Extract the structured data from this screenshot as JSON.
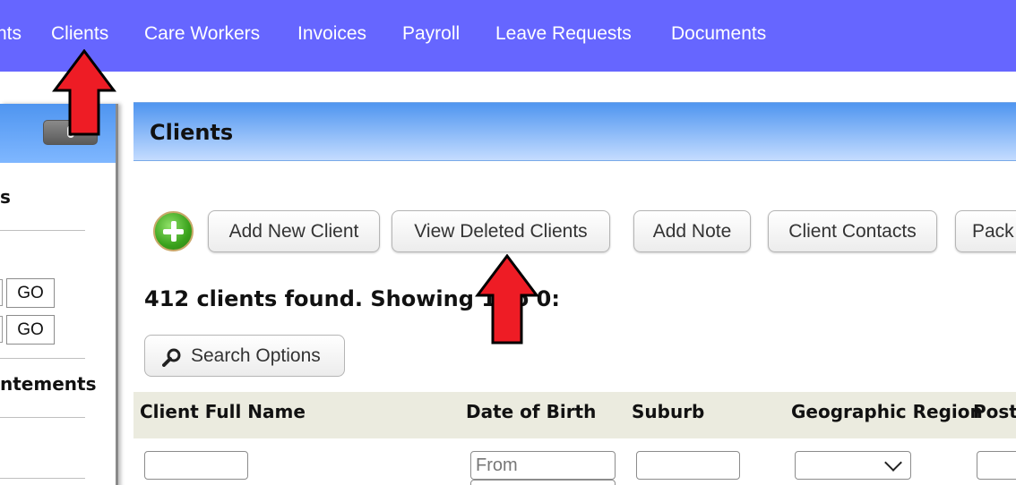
{
  "topnav": {
    "items": [
      {
        "label": "nts"
      },
      {
        "label": "Clients"
      },
      {
        "label": "Care Workers"
      },
      {
        "label": "Invoices"
      },
      {
        "label": "Payroll"
      },
      {
        "label": "Leave Requests"
      },
      {
        "label": "Documents"
      }
    ],
    "background": "#6666ff"
  },
  "sidebar": {
    "section_1": "s",
    "go_label": "GO",
    "section_2": "ntements"
  },
  "main": {
    "title": "Clients",
    "buttons": {
      "add_new_client": "Add New Client",
      "view_deleted_clients": "View Deleted Clients",
      "add_note": "Add Note",
      "client_contacts": "Client Contacts",
      "pack": "Pack"
    },
    "found_text": "412 clients found. Showing 1 to 0:",
    "search_options": "Search Options",
    "table": {
      "columns": [
        "Client Full Name",
        "Date of Birth",
        "Suburb",
        "Geographic Region",
        "Postc"
      ]
    },
    "filters": {
      "dob_from_placeholder": "From"
    }
  },
  "annotations": {
    "arrow_color": "#ee1c25"
  }
}
